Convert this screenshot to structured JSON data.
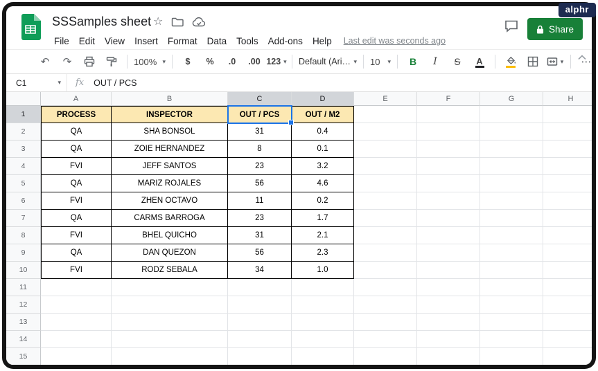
{
  "titlebar": {
    "doc_title": "SSSamples sheet",
    "watermark": "alphr",
    "share_label": "Share",
    "star": "☆"
  },
  "menubar": {
    "items": [
      "File",
      "Edit",
      "View",
      "Insert",
      "Format",
      "Data",
      "Tools",
      "Add-ons",
      "Help"
    ],
    "last_edit": "Last edit was seconds ago"
  },
  "toolbar": {
    "undo": "↶",
    "redo": "↷",
    "zoom": "100%",
    "currency": "$",
    "percent": "%",
    "decimal_decrease": ".0",
    "decimal_increase": ".00",
    "more_formats": "123",
    "font": "Default (Ari…",
    "font_size": "10",
    "bold": "B",
    "italic": "I",
    "strikethrough": "S",
    "text_color": "A",
    "more": "⋯",
    "dropdown_caret": "▾"
  },
  "formula_bar": {
    "cell_ref": "C1",
    "fx_label": "fx",
    "content": "OUT / PCS"
  },
  "sheet": {
    "column_letters": [
      "A",
      "B",
      "C",
      "D",
      "E",
      "F",
      "G",
      "H"
    ],
    "row_numbers": [
      "1",
      "2",
      "3",
      "4",
      "5",
      "6",
      "7",
      "8",
      "9",
      "10",
      "11",
      "12",
      "13",
      "14",
      "15"
    ],
    "selected_columns": [
      "C",
      "D"
    ],
    "selected_rows": [
      "1"
    ],
    "selected_cell": "C1",
    "table": {
      "headers": [
        "PROCESS",
        "INSPECTOR",
        "OUT / PCS",
        "OUT / M2"
      ],
      "rows": [
        [
          "QA",
          "SHA BONSOL",
          "31",
          "0.4"
        ],
        [
          "QA",
          "ZOIE HERNANDEZ",
          "8",
          "0.1"
        ],
        [
          "FVI",
          "JEFF SANTOS",
          "23",
          "3.2"
        ],
        [
          "QA",
          "MARIZ ROJALES",
          "56",
          "4.6"
        ],
        [
          "FVI",
          "ZHEN OCTAVO",
          "11",
          "0.2"
        ],
        [
          "QA",
          "CARMS BARROGA",
          "23",
          "1.7"
        ],
        [
          "FVI",
          "BHEL QUICHO",
          "31",
          "2.1"
        ],
        [
          "QA",
          "DAN QUEZON",
          "56",
          "2.3"
        ],
        [
          "FVI",
          "RODZ SEBALA",
          "34",
          "1.0"
        ]
      ]
    }
  },
  "colors": {
    "table_header_fill": "#fce8b2",
    "share_green": "#188038",
    "selection_blue": "#1a73e8",
    "sheets_green": "#0f9d58",
    "watermark_bg": "#1d2b50"
  }
}
